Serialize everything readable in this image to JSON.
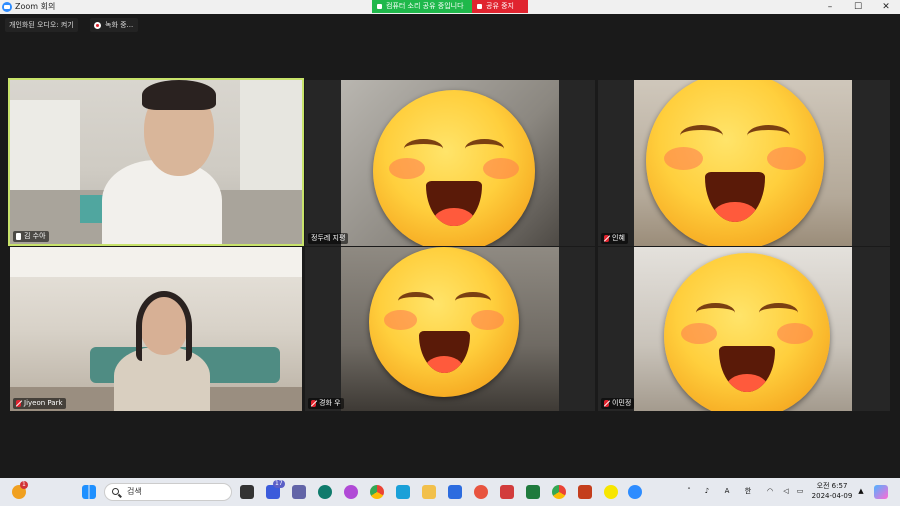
{
  "window": {
    "title": "Zoom 회의",
    "share_status": "컴퓨터 소리 공유 중입니다",
    "stop_share": "공유 중지",
    "controls": [
      "–",
      "☐",
      "✕"
    ]
  },
  "topbar": {
    "audio_label": "개인화된 오디오: 켜기",
    "recording_label": "녹화 중..."
  },
  "participants": [
    {
      "name": "김 수아",
      "mic": "pinned",
      "active_speaker": true
    },
    {
      "name": "정두레 지평",
      "mic": "none",
      "active_speaker": false
    },
    {
      "name": "인혜",
      "mic": "muted",
      "active_speaker": false
    },
    {
      "name": "Jiyeon Park",
      "mic": "muted",
      "active_speaker": false
    },
    {
      "name": "경화 우",
      "mic": "muted",
      "active_speaker": false
    },
    {
      "name": "이민정",
      "mic": "muted",
      "active_speaker": false
    }
  ],
  "taskbar": {
    "search_placeholder": "검색",
    "notification_count": "1",
    "teams_badge": "17",
    "ime_letter": "A",
    "ime_lang": "한",
    "time": "오전 6:57",
    "date": "2024-04-09",
    "colors": {
      "accent": "#2d8cff",
      "speaker_border": "#c8e36b",
      "share_green": "#1fb84b",
      "stop_red": "#e0242f"
    }
  }
}
